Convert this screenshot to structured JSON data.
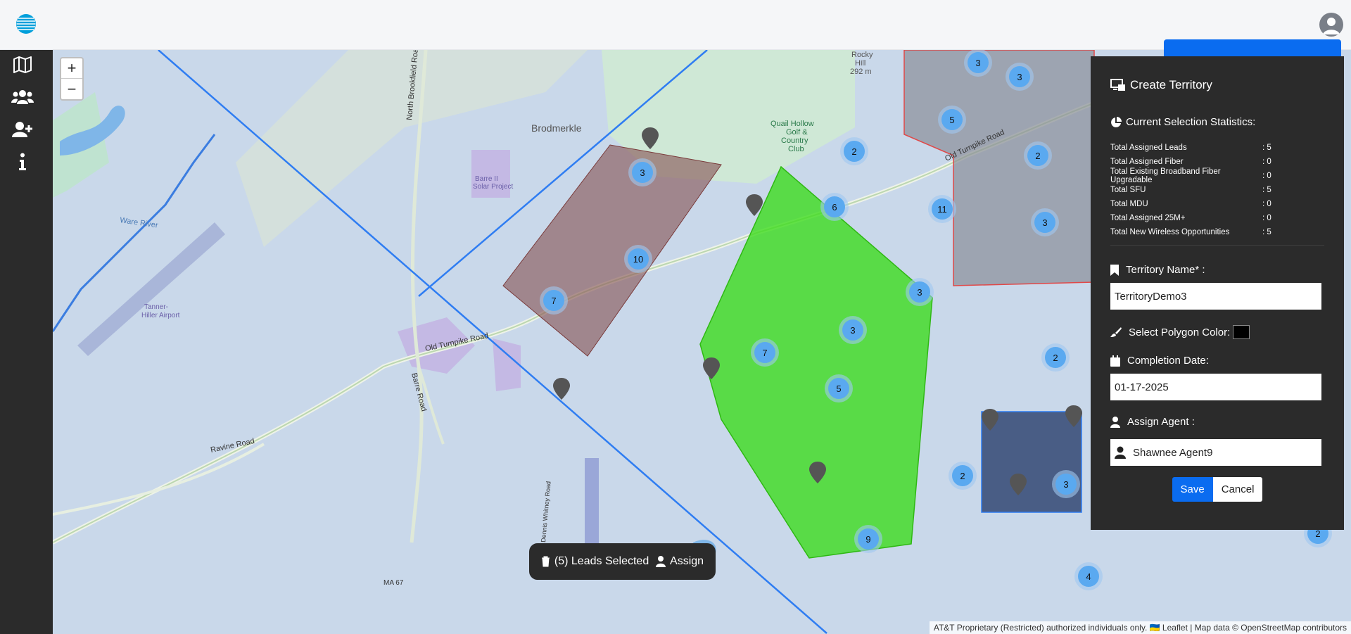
{
  "header": {
    "logo": "att-globe-logo",
    "user": "user-avatar"
  },
  "sidebar": {
    "items": [
      {
        "name": "map",
        "icon": "map-icon"
      },
      {
        "name": "team",
        "icon": "users-icon"
      },
      {
        "name": "add-user",
        "icon": "user-plus-icon"
      },
      {
        "name": "info",
        "icon": "info-icon"
      }
    ]
  },
  "map": {
    "zoom_in": "+",
    "zoom_out": "−",
    "attribution": "AT&T Proprietary (Restricted) authorized individuals only. 🇺🇦 Leaflet | Map data © OpenStreetMap contributors",
    "labels": {
      "place1": "Brodmerkle",
      "rocky": "Rocky",
      "hill": "Hill",
      "elev": "292 m",
      "golf1": "Quail Hollow",
      "golf2": "Golf &",
      "golf3": "Country",
      "golf4": "Club",
      "solar1": "Barre II",
      "solar2": "Solar Project",
      "airport1": "Tanner-",
      "airport2": "Hiller Airport",
      "road_ot": "Old Turnpike Road",
      "road_ot2": "Old Turnpike Road",
      "road_rav": "Ravine Road",
      "road_barre": "Barre Road",
      "road_nbr": "North Brookfield Road",
      "road_ma67": "MA 67",
      "road_dw": "Dennis Whitney Road",
      "road_ware": "Ware River"
    },
    "clusters": [
      "3",
      "3",
      "5",
      "2",
      "2",
      "3",
      "6",
      "11",
      "3",
      "10",
      "7",
      "3",
      "7",
      "5",
      "3",
      "2",
      "2",
      "3",
      "9",
      "4",
      "2"
    ],
    "colors": {
      "cluster": "#5aa9f0",
      "polygon_brown": "#8b5a5a",
      "polygon_green": "#3ddc1e",
      "polygon_gray": "#8a8f99",
      "polygon_navy": "#1e3463",
      "line_blue": "#2f7df2"
    }
  },
  "leads_bar": {
    "selected": "(5) Leads Selected",
    "assign": "Assign"
  },
  "panel": {
    "title": "Create Territory",
    "stats_title": "Current Selection Statistics:",
    "stats": [
      {
        "k": "Total Assigned Leads",
        "v": ": 5"
      },
      {
        "k": "Total Assigned Fiber",
        "v": ": 0"
      },
      {
        "k": "Total Existing Broadband Fiber Upgradable",
        "v": ": 0"
      },
      {
        "k": "Total SFU",
        "v": ": 5"
      },
      {
        "k": "Total MDU",
        "v": ": 0"
      },
      {
        "k": "Total Assigned 25M+",
        "v": ": 0"
      },
      {
        "k": "Total New Wireless Opportunities",
        "v": ": 5"
      }
    ],
    "name_label": "Territory Name* :",
    "name_value": "TerritoryDemo3",
    "color_label": "Select Polygon Color:",
    "date_label": "Completion Date:",
    "date_value": "01-17-2025",
    "agent_label": "Assign Agent :",
    "agent_value": "Shawnee Agent9",
    "save": "Save",
    "cancel": "Cancel"
  }
}
